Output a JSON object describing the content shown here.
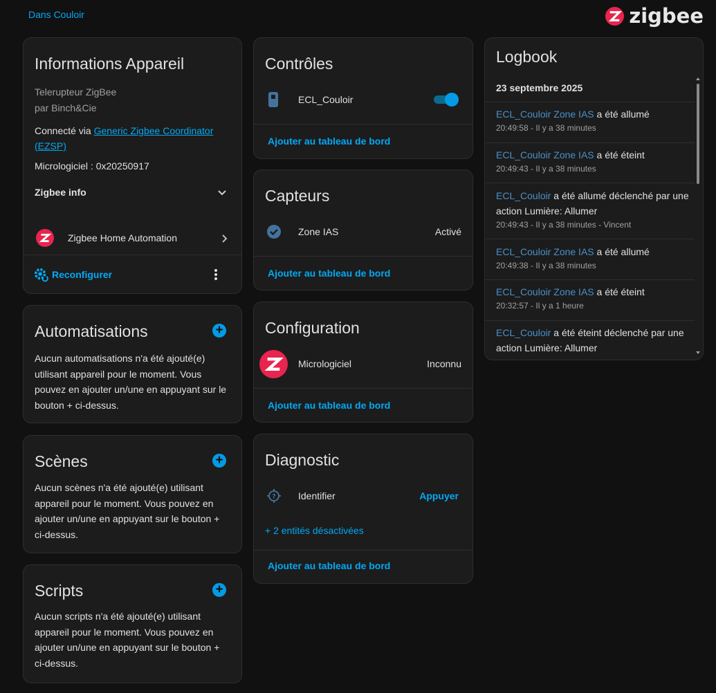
{
  "header": {
    "area": "Dans Couloir",
    "brand": "zigbee",
    "brand_color": "#e8254e"
  },
  "device_info": {
    "title": "Informations Appareil",
    "model": "Telerupteur ZigBee",
    "manufacturer": "par Binch&Cie",
    "connected_prefix": "Connecté via ",
    "connected_link": "Generic Zigbee Coordinator (EZSP)",
    "firmware": "Micrologiciel : 0x20250917",
    "zigbee_info": "Zigbee info",
    "integration": "Zigbee Home Automation",
    "reconfigure": "Reconfigurer"
  },
  "automations": {
    "title": "Automatisations",
    "text": "Aucun automatisations n'a été ajouté(e) utilisant appareil pour le moment. Vous pouvez en ajouter un/une en appuyant sur le bouton + ci-dessus."
  },
  "scenes": {
    "title": "Scènes",
    "text": "Aucun scènes n'a été ajouté(e) utilisant appareil pour le moment. Vous pouvez en ajouter un/une en appuyant sur le bouton + ci-dessus."
  },
  "scripts": {
    "title": "Scripts",
    "text": "Aucun scripts n'a été ajouté(e) utilisant appareil pour le moment. Vous pouvez en ajouter un/une en appuyant sur le bouton + ci-dessus."
  },
  "controls": {
    "title": "Contrôles",
    "entity": "ECL_Couloir",
    "state_on": true,
    "add": "Ajouter au tableau de bord"
  },
  "sensors": {
    "title": "Capteurs",
    "entity": "Zone IAS",
    "state": "Activé",
    "add": "Ajouter au tableau de bord"
  },
  "configuration": {
    "title": "Configuration",
    "entity": "Micrologiciel",
    "state": "Inconnu",
    "add": "Ajouter au tableau de bord"
  },
  "diagnostic": {
    "title": "Diagnostic",
    "entity": "Identifier",
    "action": "Appuyer",
    "disabled": "+ 2 entités désactivées",
    "add": "Ajouter au tableau de bord"
  },
  "logbook": {
    "title": "Logbook",
    "date": "23 septembre 2025",
    "entries": [
      {
        "entity": "ECL_Couloir Zone IAS",
        "message": " a été allumé",
        "time": "20:49:58 - Il y a 38 minutes"
      },
      {
        "entity": "ECL_Couloir Zone IAS",
        "message": " a été éteint",
        "time": "20:49:43 - Il y a 38 minutes"
      },
      {
        "entity": "ECL_Couloir",
        "message": " a été allumé déclenché par une action Lumière: Allumer",
        "time": "20:49:43 - Il y a 38 minutes - Vincent"
      },
      {
        "entity": "ECL_Couloir Zone IAS",
        "message": " a été allumé",
        "time": "20:49:38 - Il y a 38 minutes"
      },
      {
        "entity": "ECL_Couloir Zone IAS",
        "message": " a été éteint",
        "time": "20:32:57 - Il y a 1 heure"
      },
      {
        "entity": "ECL_Couloir",
        "message": " a été éteint déclenché par une action Lumière: Allumer",
        "time": ""
      }
    ]
  }
}
